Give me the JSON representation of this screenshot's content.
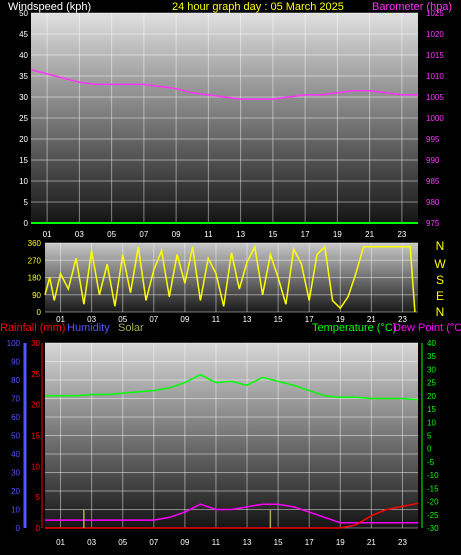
{
  "header": {
    "left_label": "Windspeed (kph)",
    "center_label": "24 hour graph day : 05 March 2025",
    "right_label": "Barometer (hpa)"
  },
  "direction_panel": {
    "compass": [
      "N",
      "W",
      "S",
      "E",
      "N"
    ]
  },
  "bottom_header": {
    "rainfall_label": "Rainfall (mm)",
    "humidity_label": "Humidity",
    "solar_label": "Solar",
    "temperature_label": "Temperature (°C)",
    "dewpoint_label": "Dew Point (°C)"
  },
  "colors": {
    "wind": "#ffffff",
    "barometer": "#ff33ff",
    "direction": "#ffff00",
    "rainfall": "#ff0000",
    "humidity": "#5555ff",
    "solar": "#aaaa55",
    "temperature": "#00ff00",
    "dewpoint": "#ff00ff"
  },
  "chart_data": [
    {
      "type": "line",
      "name": "wind-and-pressure",
      "x_ticks": [
        "01",
        "03",
        "05",
        "07",
        "09",
        "11",
        "13",
        "15",
        "17",
        "19",
        "21",
        "23"
      ],
      "x": [
        0,
        1,
        2,
        3,
        4,
        5,
        6,
        7,
        8,
        9,
        10,
        11,
        12,
        13,
        14,
        15,
        16,
        17,
        18,
        19,
        20,
        21,
        22,
        23,
        24
      ],
      "left_axis": {
        "ylim": [
          0,
          50
        ],
        "ticks": [
          "0",
          "5",
          "10",
          "15",
          "20",
          "25",
          "30",
          "35",
          "40",
          "45",
          "50"
        ]
      },
      "right_axis": {
        "ylim": [
          975,
          1025
        ],
        "ticks": [
          "975",
          "980",
          "985",
          "990",
          "995",
          "1000",
          "1005",
          "1010",
          "1015",
          "1020",
          "1025"
        ]
      },
      "series": [
        {
          "name": "Windspeed",
          "axis": "left",
          "values": [
            0,
            0,
            0,
            0,
            0,
            0,
            0,
            0,
            0,
            0,
            0,
            0,
            0,
            0,
            0,
            0,
            0,
            0,
            0,
            0,
            0,
            0,
            0,
            0,
            0
          ]
        },
        {
          "name": "Barometer",
          "axis": "right",
          "values": [
            1011.5,
            1010.5,
            1009.5,
            1008.5,
            1008,
            1008,
            1008,
            1008,
            1007.5,
            1007,
            1006,
            1005.5,
            1005,
            1004.5,
            1004.5,
            1004.5,
            1005,
            1005.5,
            1005.5,
            1006,
            1006.5,
            1006.5,
            1006,
            1005.5,
            1005.5
          ]
        }
      ],
      "grid": true
    },
    {
      "type": "line",
      "name": "wind-direction",
      "x_ticks": [
        "01",
        "03",
        "05",
        "07",
        "09",
        "11",
        "13",
        "15",
        "17",
        "19",
        "21",
        "23"
      ],
      "ylim": [
        0,
        360
      ],
      "y_ticks": [
        "0",
        "90",
        "180",
        "270",
        "360"
      ],
      "series": [
        {
          "name": "Direction",
          "x": [
            0,
            0.3,
            0.6,
            1,
            1.5,
            2,
            2.5,
            3,
            3.5,
            4,
            4.5,
            5,
            5.5,
            6,
            6.5,
            7,
            7.5,
            8,
            8.5,
            9,
            9.5,
            10,
            10.5,
            11,
            11.5,
            12,
            12.5,
            13,
            13.5,
            14,
            14.5,
            15,
            15.5,
            16,
            16.5,
            17,
            17.5,
            18,
            18.5,
            19,
            19.5,
            20,
            20.5,
            21,
            21.5,
            22,
            22.5,
            23,
            23.5,
            23.8
          ],
          "values": [
            90,
            180,
            60,
            200,
            120,
            280,
            40,
            320,
            90,
            250,
            30,
            300,
            100,
            340,
            60,
            220,
            320,
            80,
            300,
            150,
            340,
            60,
            280,
            200,
            30,
            310,
            120,
            260,
            340,
            90,
            300,
            180,
            40,
            330,
            250,
            60,
            300,
            340,
            60,
            20,
            80,
            200,
            340,
            340,
            340,
            340,
            340,
            340,
            340,
            0
          ]
        }
      ],
      "grid": true
    },
    {
      "type": "line",
      "name": "temperature-humidity-rain",
      "x_ticks": [
        "01",
        "03",
        "05",
        "07",
        "09",
        "11",
        "13",
        "15",
        "17",
        "19",
        "21",
        "23"
      ],
      "x": [
        0,
        1,
        2,
        3,
        4,
        5,
        6,
        7,
        8,
        9,
        10,
        11,
        12,
        13,
        14,
        15,
        16,
        17,
        18,
        19,
        20,
        21,
        22,
        23,
        24
      ],
      "humidity_axis": {
        "ylim": [
          0,
          100
        ],
        "ticks": [
          "0",
          "10",
          "20",
          "30",
          "40",
          "50",
          "60",
          "70",
          "80",
          "90",
          "100"
        ]
      },
      "rain_axis": {
        "ylim": [
          0,
          30
        ],
        "ticks": [
          "0",
          "5",
          "10",
          "15",
          "20",
          "25",
          "30"
        ]
      },
      "temp_axis": {
        "ylim": [
          -30,
          40
        ],
        "ticks": [
          "-30",
          "-25",
          "-20",
          "-15",
          "-10",
          "-5",
          "0",
          "5",
          "10",
          "15",
          "20",
          "25",
          "30",
          "35",
          "40"
        ]
      },
      "series": [
        {
          "name": "Temperature",
          "axis": "temp",
          "values": [
            20,
            20,
            20,
            20.5,
            20.5,
            21,
            21.5,
            22,
            23,
            25,
            28,
            25,
            25.5,
            24,
            27,
            25.5,
            24,
            22,
            20,
            19.5,
            19.5,
            19,
            19,
            19,
            18.5
          ]
        },
        {
          "name": "Dew Point",
          "axis": "temp",
          "values": [
            -27,
            -27,
            -27,
            -27,
            -27,
            -27,
            -27,
            -27,
            -26,
            -24,
            -21,
            -23,
            -23,
            -22,
            -21,
            -21,
            -22,
            -24,
            -26,
            -28,
            -28,
            -28,
            -28,
            -28,
            -28
          ]
        },
        {
          "name": "Rainfall",
          "axis": "rain",
          "values": [
            0,
            0,
            0,
            0,
            0,
            0,
            0,
            0,
            0,
            0,
            0,
            0,
            0,
            0,
            0,
            0,
            0,
            0,
            0,
            0,
            0.5,
            2,
            3,
            3.5,
            4
          ]
        },
        {
          "name": "Solar",
          "axis": "humidity",
          "spikes": [
            [
              2.5,
              5
            ],
            [
              14.5,
              5
            ]
          ]
        }
      ],
      "grid": true
    }
  ]
}
